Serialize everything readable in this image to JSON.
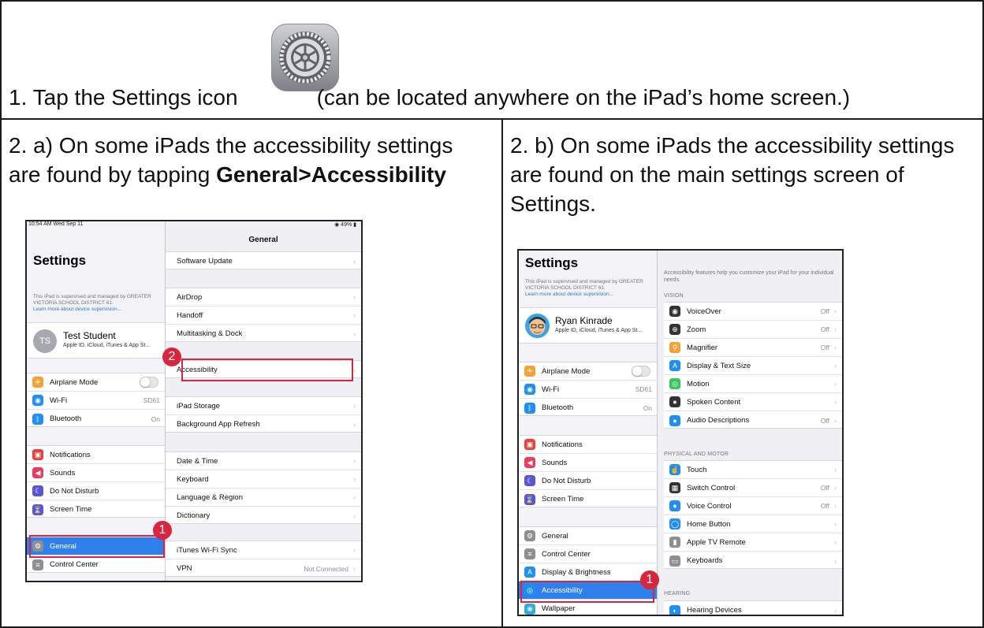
{
  "step1": {
    "before": "1. Tap the Settings icon",
    "after": "(can be located anywhere on the iPad’s home screen.)",
    "icon": "settings-gear-icon"
  },
  "step2a": {
    "line1": "2. a) On some iPads the accessibility settings",
    "line2_prefix": "are found by tapping ",
    "line2_bold": "General>Accessibility"
  },
  "step2b": {
    "line1": "2. b) On some iPads the accessibility settings",
    "line2": "are found on the main settings screen of",
    "line3": "Settings."
  },
  "shotA": {
    "status_time": "10:54 AM  Wed Sep 11",
    "status_right": "49%",
    "title": "Settings",
    "supervised": "This iPad is supervised and managed by GREATER VICTORIA SCHOOL DISTRICT 61.",
    "supervised_link": "Learn more about device supervision...",
    "profile_initials": "TS",
    "profile_name": "Test Student",
    "profile_sub": "Apple ID, iCloud, iTunes & App St...",
    "group1": [
      {
        "label": "Airplane Mode",
        "value": "",
        "toggle": true,
        "color": "#f7a034",
        "icon": "airplane-icon",
        "glyph": "✈"
      },
      {
        "label": "Wi-Fi",
        "value": "SD61",
        "color": "#1e8ff7",
        "icon": "wifi-icon",
        "glyph": "◉"
      },
      {
        "label": "Bluetooth",
        "value": "On",
        "color": "#1e8ff7",
        "icon": "bluetooth-icon",
        "glyph": "ᛒ"
      }
    ],
    "group2": [
      {
        "label": "Notifications",
        "color": "#f23b3b",
        "icon": "notifications-icon",
        "glyph": "▣"
      },
      {
        "label": "Sounds",
        "color": "#ee3a5b",
        "icon": "sounds-icon",
        "glyph": "◀"
      },
      {
        "label": "Do Not Disturb",
        "color": "#5b55d9",
        "icon": "moon-icon",
        "glyph": "☾"
      },
      {
        "label": "Screen Time",
        "color": "#5b55d9",
        "icon": "hourglass-icon",
        "glyph": "⌛"
      }
    ],
    "group3": [
      {
        "label": "General",
        "color": "#8e8e93",
        "icon": "gear-icon",
        "glyph": "⚙",
        "selected": true
      },
      {
        "label": "Control Center",
        "color": "#8e8e93",
        "icon": "control-center-icon",
        "glyph": "≡"
      }
    ],
    "detail_title": "General",
    "d_group1": [
      {
        "label": "Software Update",
        "value": ""
      }
    ],
    "d_group2": [
      {
        "label": "AirDrop",
        "value": ""
      },
      {
        "label": "Handoff",
        "value": ""
      },
      {
        "label": "Multitasking & Dock",
        "value": ""
      }
    ],
    "d_group3": [
      {
        "label": "Accessibility",
        "value": ""
      }
    ],
    "d_group4": [
      {
        "label": "iPad Storage",
        "value": ""
      },
      {
        "label": "Background App Refresh",
        "value": ""
      }
    ],
    "d_group5": [
      {
        "label": "Date & Time",
        "value": ""
      },
      {
        "label": "Keyboard",
        "value": ""
      },
      {
        "label": "Language & Region",
        "value": ""
      },
      {
        "label": "Dictionary",
        "value": ""
      }
    ],
    "d_group6": [
      {
        "label": "iTunes Wi-Fi Sync",
        "value": ""
      },
      {
        "label": "VPN",
        "value": "Not Connected"
      }
    ],
    "badge1": "1",
    "badge2": "2"
  },
  "shotB": {
    "title": "Settings",
    "supervised": "This iPad is supervised and managed by GREATER VICTORIA SCHOOL DISTRICT 61.",
    "supervised_link": "Learn more about device supervision...",
    "profile_name": "Ryan Kinrade",
    "profile_sub": "Apple ID, iCloud, iTunes & App St...",
    "group1": [
      {
        "label": "Airplane Mode",
        "value": "",
        "toggle": true,
        "color": "#f7a034",
        "icon": "airplane-icon",
        "glyph": "✈"
      },
      {
        "label": "Wi-Fi",
        "value": "SD61",
        "color": "#1e8ff7",
        "icon": "wifi-icon",
        "glyph": "◉"
      },
      {
        "label": "Bluetooth",
        "value": "On",
        "color": "#1e8ff7",
        "icon": "bluetooth-icon",
        "glyph": "ᛒ"
      }
    ],
    "group2": [
      {
        "label": "Notifications",
        "color": "#f23b3b",
        "icon": "notifications-icon",
        "glyph": "▣"
      },
      {
        "label": "Sounds",
        "color": "#ee3a5b",
        "icon": "sounds-icon",
        "glyph": "◀"
      },
      {
        "label": "Do Not Disturb",
        "color": "#5b55d9",
        "icon": "moon-icon",
        "glyph": "☾"
      },
      {
        "label": "Screen Time",
        "color": "#5b55d9",
        "icon": "hourglass-icon",
        "glyph": "⌛"
      }
    ],
    "group3": [
      {
        "label": "General",
        "color": "#8e8e93",
        "icon": "gear-icon",
        "glyph": "⚙"
      },
      {
        "label": "Control Center",
        "color": "#8e8e93",
        "icon": "control-center-icon",
        "glyph": "≡"
      },
      {
        "label": "Display & Brightness",
        "color": "#1e8ff7",
        "icon": "display-icon",
        "glyph": "A"
      },
      {
        "label": "Accessibility",
        "color": "#1e8ff7",
        "icon": "accessibility-icon",
        "glyph": "◎",
        "selected": true
      },
      {
        "label": "Wallpaper",
        "color": "#35aadc",
        "icon": "wallpaper-icon",
        "glyph": "❀"
      }
    ],
    "intro": "Accessibility features help you customize your iPad for your individual needs.",
    "sec_vision": "VISION",
    "vision": [
      {
        "label": "VoiceOver",
        "value": "Off",
        "color": "#333333",
        "icon": "voiceover-icon",
        "glyph": "◉"
      },
      {
        "label": "Zoom",
        "value": "Off",
        "color": "#333333",
        "icon": "zoom-icon",
        "glyph": "⊕"
      },
      {
        "label": "Magnifier",
        "value": "Off",
        "color": "#f7a034",
        "icon": "magnifier-icon",
        "glyph": "⚲"
      },
      {
        "label": "Display & Text Size",
        "value": "",
        "color": "#1e8ff7",
        "icon": "text-size-icon",
        "glyph": "A"
      },
      {
        "label": "Motion",
        "value": "",
        "color": "#34c759",
        "icon": "motion-icon",
        "glyph": "◎"
      },
      {
        "label": "Spoken Content",
        "value": "",
        "color": "#333333",
        "icon": "speech-icon",
        "glyph": "●"
      },
      {
        "label": "Audio Descriptions",
        "value": "Off",
        "color": "#1e8ff7",
        "icon": "audio-descriptions-icon",
        "glyph": "●"
      }
    ],
    "sec_physical": "PHYSICAL AND MOTOR",
    "physical": [
      {
        "label": "Touch",
        "value": "",
        "color": "#1e8ff7",
        "icon": "touch-icon",
        "glyph": "☝"
      },
      {
        "label": "Switch Control",
        "value": "Off",
        "color": "#333333",
        "icon": "switch-control-icon",
        "glyph": "▦"
      },
      {
        "label": "Voice Control",
        "value": "Off",
        "color": "#1e8ff7",
        "icon": "voice-control-icon",
        "glyph": "●"
      },
      {
        "label": "Home Button",
        "value": "",
        "color": "#1e8ff7",
        "icon": "home-button-icon",
        "glyph": "◯"
      },
      {
        "label": "Apple TV Remote",
        "value": "",
        "color": "#8e8e93",
        "icon": "remote-icon",
        "glyph": "▮"
      },
      {
        "label": "Keyboards",
        "value": "",
        "color": "#8e8e93",
        "icon": "keyboard-icon",
        "glyph": "▭"
      }
    ],
    "sec_hearing": "HEARING",
    "hearing": [
      {
        "label": "Hearing Devices",
        "value": "",
        "color": "#1e8ff7",
        "icon": "hearing-devices-icon",
        "glyph": "◐"
      }
    ],
    "badge1": "1"
  }
}
